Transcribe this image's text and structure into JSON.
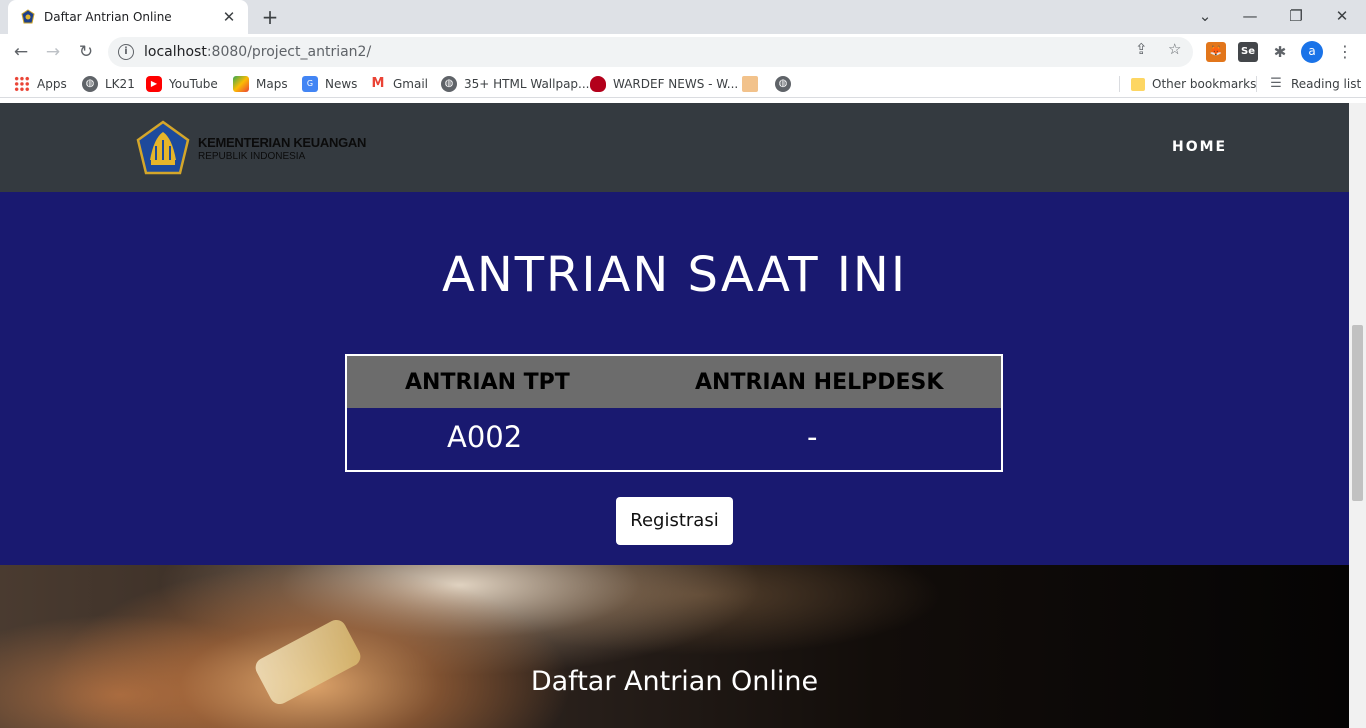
{
  "browser": {
    "tab_title": "Daftar Antrian Online",
    "url_host": "localhost",
    "url_path": ":8080/project_antrian2/",
    "profile_initial": "a",
    "bookmarks": [
      "Apps",
      "LK21",
      "YouTube",
      "Maps",
      "News",
      "Gmail",
      "35+ HTML Wallpap...",
      "WARDEF NEWS - W..."
    ],
    "other_bookmarks": "Other bookmarks",
    "reading_list": "Reading list"
  },
  "site": {
    "logo_line1": "KEMENTERIAN KEUANGAN",
    "logo_line2": "REPUBLIK INDONESIA",
    "nav_home": "HOME",
    "hero_title": "ANTRIAN SAAT INI",
    "table": {
      "col1_header": "ANTRIAN TPT",
      "col2_header": "ANTRIAN HELPDESK",
      "col1_value": "A002",
      "col2_value": "-"
    },
    "register_button": "Registrasi",
    "section_title": "Daftar Antrian Online"
  },
  "colors": {
    "navbar": "#343a40",
    "hero": "#191970",
    "table_header": "#6c6c6c"
  }
}
